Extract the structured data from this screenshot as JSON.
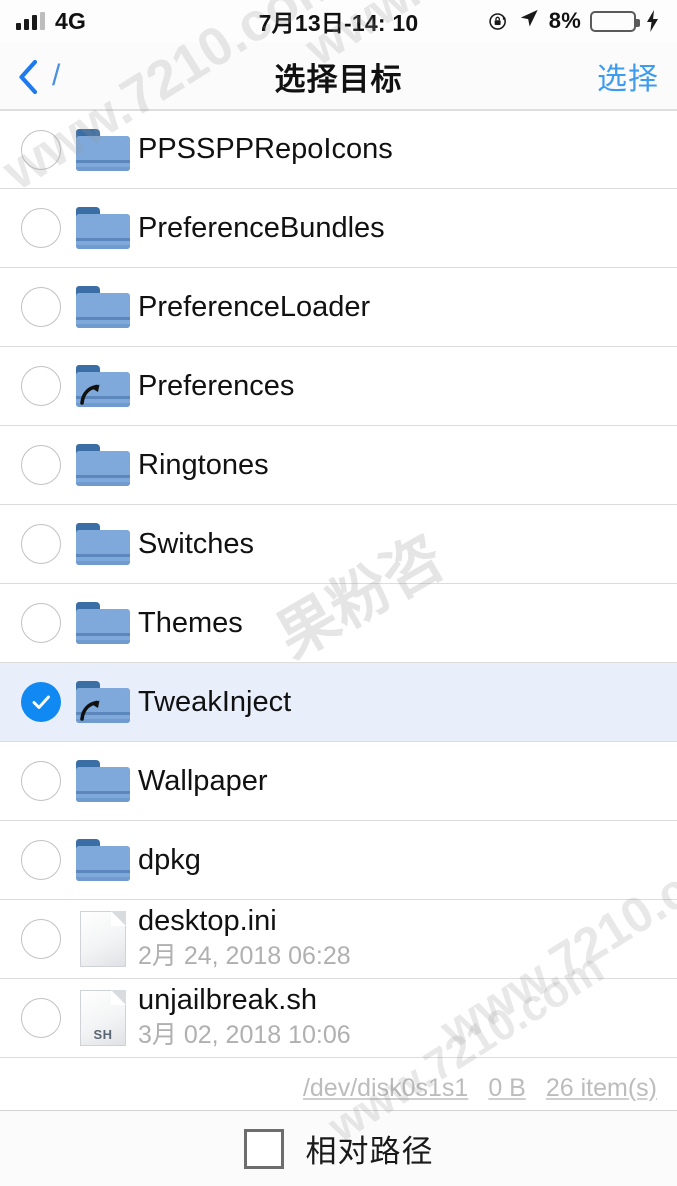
{
  "status_bar": {
    "carrier": "4G",
    "time": "7月13日-14: 10",
    "battery_percent": "8%",
    "icons": [
      "signal-bars-icon",
      "rotation-lock-icon",
      "location-arrow-icon",
      "battery-icon",
      "charging-bolt-icon"
    ],
    "battery_fill_color": "#f0342e",
    "battery_level": 8
  },
  "nav_bar": {
    "back_label": "/",
    "title": "选择目标",
    "action_label": "选择",
    "accent_color": "#3d9bf0"
  },
  "list": {
    "items": [
      {
        "name": "PPSSPPRepoIcons",
        "subtitle": "",
        "type": "folder",
        "symlink": false,
        "selected": false
      },
      {
        "name": "PreferenceBundles",
        "subtitle": "",
        "type": "folder",
        "symlink": false,
        "selected": false
      },
      {
        "name": "PreferenceLoader",
        "subtitle": "",
        "type": "folder",
        "symlink": false,
        "selected": false
      },
      {
        "name": "Preferences",
        "subtitle": "",
        "type": "folder",
        "symlink": true,
        "selected": false
      },
      {
        "name": "Ringtones",
        "subtitle": "",
        "type": "folder",
        "symlink": false,
        "selected": false
      },
      {
        "name": "Switches",
        "subtitle": "",
        "type": "folder",
        "symlink": false,
        "selected": false
      },
      {
        "name": "Themes",
        "subtitle": "",
        "type": "folder",
        "symlink": false,
        "selected": false
      },
      {
        "name": "TweakInject",
        "subtitle": "",
        "type": "folder",
        "symlink": true,
        "selected": true
      },
      {
        "name": "Wallpaper",
        "subtitle": "",
        "type": "folder",
        "symlink": false,
        "selected": false
      },
      {
        "name": "dpkg",
        "subtitle": "",
        "type": "folder",
        "symlink": false,
        "selected": false
      },
      {
        "name": "desktop.ini",
        "subtitle": "2月 24, 2018 06:28",
        "type": "file",
        "ext": "",
        "symlink": false,
        "selected": false
      },
      {
        "name": "unjailbreak.sh",
        "subtitle": "3月 02, 2018 10:06",
        "type": "file",
        "ext": "SH",
        "symlink": false,
        "selected": false
      }
    ],
    "selected_row_color": "#e9eefb",
    "check_color": "#1189f3"
  },
  "footer": {
    "device": "/dev/disk0s1s1",
    "size": "0 B",
    "count": "26 item(s)"
  },
  "toolbar": {
    "relative_path_label": "相对路径",
    "relative_path_checked": false
  },
  "watermarks": {
    "url": "www.7210.com",
    "cn": "果粉咨"
  }
}
